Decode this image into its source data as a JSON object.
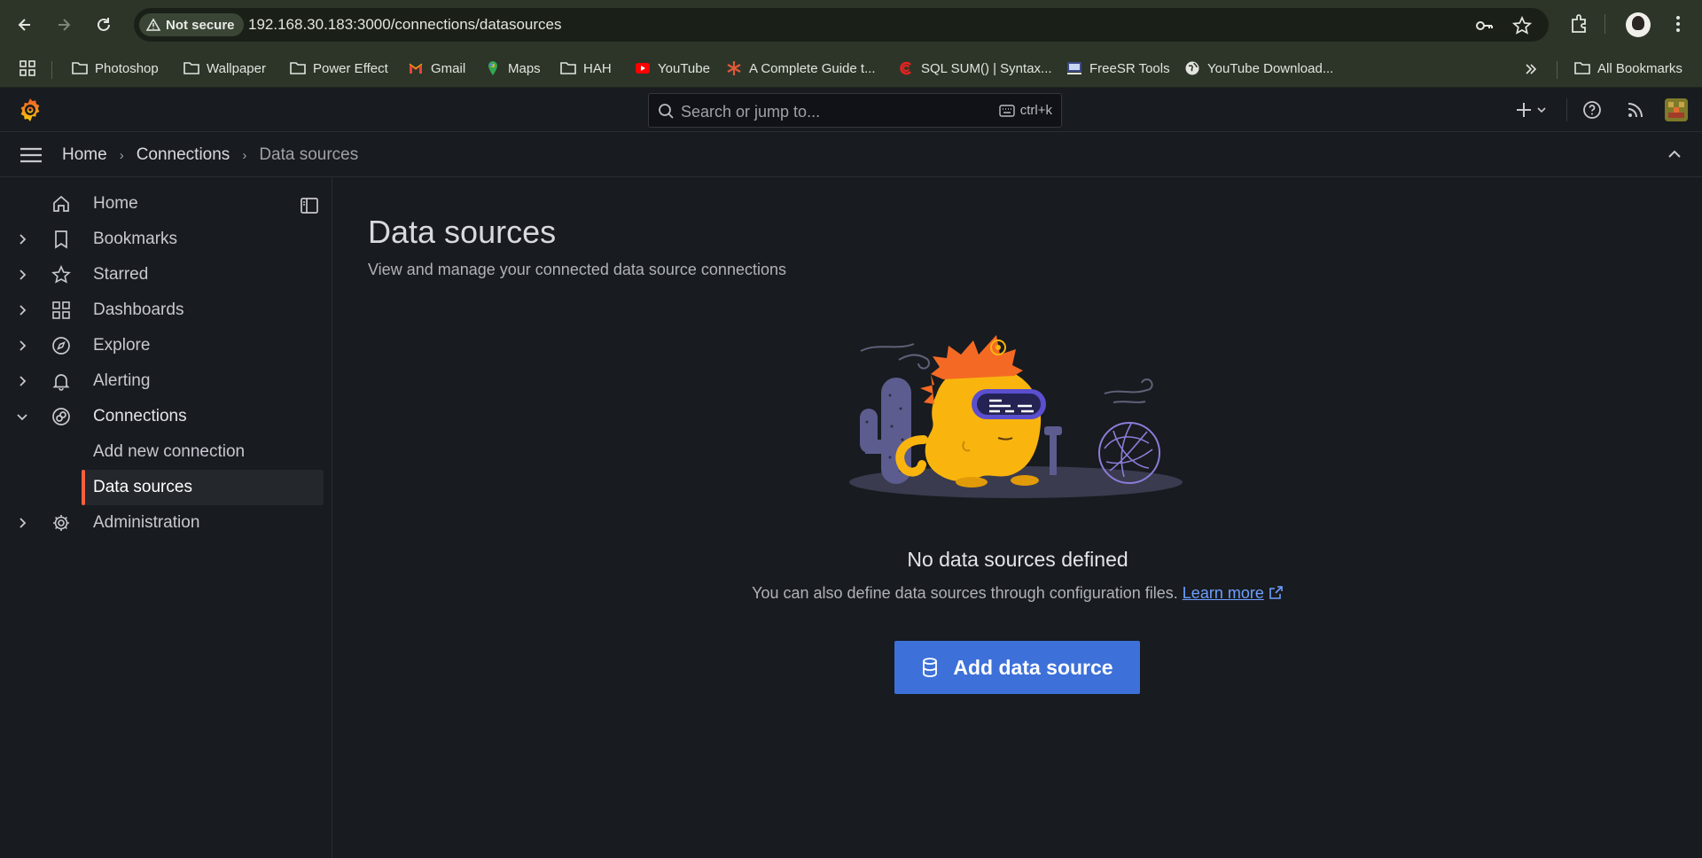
{
  "browser": {
    "security_label": "Not secure",
    "url": "192.168.30.183:3000/connections/datasources"
  },
  "bookmarks": {
    "items": [
      {
        "label": "Photoshop",
        "icon": "folder-icon"
      },
      {
        "label": "Wallpaper",
        "icon": "folder-icon"
      },
      {
        "label": "Power Effect",
        "icon": "folder-icon"
      },
      {
        "label": "Gmail",
        "icon": "gmail-icon"
      },
      {
        "label": "Maps",
        "icon": "maps-icon"
      },
      {
        "label": "HAH",
        "icon": "folder-icon"
      },
      {
        "label": "YouTube",
        "icon": "youtube-icon"
      },
      {
        "label": "A Complete Guide t...",
        "icon": "asterisk-icon"
      },
      {
        "label": "SQL SUM() | Syntax...",
        "icon": "sql-site-icon"
      },
      {
        "label": "FreeSR Tools",
        "icon": "freesr-icon"
      },
      {
        "label": "YouTube Download...",
        "icon": "globe-icon"
      }
    ],
    "all_label": "All Bookmarks"
  },
  "topbar": {
    "search_placeholder": "Search or jump to...",
    "search_shortcut": "ctrl+k"
  },
  "breadcrumb": {
    "items": [
      "Home",
      "Connections",
      "Data sources"
    ]
  },
  "sidebar": {
    "items": [
      {
        "label": "Home"
      },
      {
        "label": "Bookmarks"
      },
      {
        "label": "Starred"
      },
      {
        "label": "Dashboards"
      },
      {
        "label": "Explore"
      },
      {
        "label": "Alerting"
      },
      {
        "label": "Connections"
      },
      {
        "label": "Administration"
      }
    ],
    "sub_items": [
      {
        "label": "Add new connection"
      },
      {
        "label": "Data sources"
      }
    ]
  },
  "main": {
    "title": "Data sources",
    "subtitle": "View and manage your connected data source connections",
    "empty_title": "No data sources defined",
    "empty_desc": "You can also define data sources through configuration files.",
    "learn_more": "Learn more",
    "add_button": "Add data source"
  },
  "colors": {
    "accent_blue": "#3d71d9",
    "active_indicator": "#f55f3e",
    "link": "#6e9fff",
    "background": "#181b1f"
  }
}
